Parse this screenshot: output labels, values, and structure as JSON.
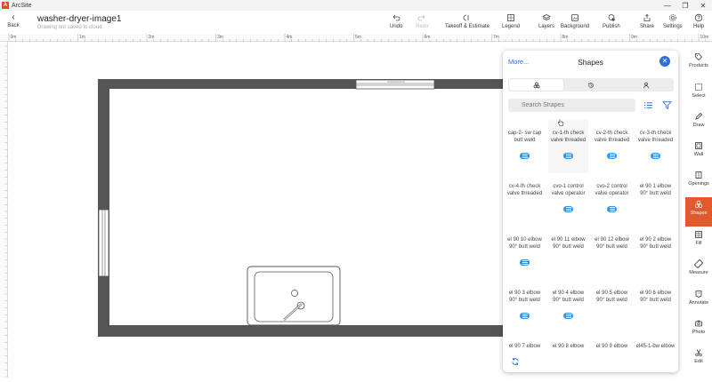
{
  "window": {
    "app_name": "ArcSite",
    "logo_letter": "A",
    "controls": [
      "—",
      "❐",
      "✕"
    ]
  },
  "toolbar": {
    "back_label": "Back",
    "title": "washer-dryer-image1",
    "subtitle": "Drawing not saved to cloud.",
    "tools": [
      {
        "name": "undo",
        "label": "Undo",
        "enabled": true
      },
      {
        "name": "redo",
        "label": "Redo",
        "enabled": false
      },
      {
        "name": "takeoff",
        "label": "Takeoff & Estimate",
        "enabled": true
      },
      {
        "name": "legend",
        "label": "Legend",
        "enabled": true
      },
      {
        "name": "layers",
        "label": "Layers",
        "enabled": true
      },
      {
        "name": "background",
        "label": "Background",
        "enabled": true
      },
      {
        "name": "publish",
        "label": "Publish",
        "enabled": true
      },
      {
        "name": "share",
        "label": "Share",
        "enabled": true
      },
      {
        "name": "settings",
        "label": "Settings",
        "enabled": true
      },
      {
        "name": "help",
        "label": "Help",
        "enabled": true
      }
    ]
  },
  "ruler": {
    "top_labels": [
      "0m",
      "1m",
      "2m",
      "3m",
      "4m",
      "5m",
      "6m",
      "7m",
      "8m",
      "9m",
      "10m"
    ]
  },
  "rail": {
    "items": [
      {
        "name": "products",
        "label": "Products",
        "active": false
      },
      {
        "name": "select",
        "label": "Select",
        "active": false
      },
      {
        "name": "draw",
        "label": "Draw",
        "active": false
      },
      {
        "name": "wall",
        "label": "Wall",
        "active": false
      },
      {
        "name": "openings",
        "label": "Openings",
        "active": false
      },
      {
        "name": "shapes",
        "label": "Shapes",
        "active": true
      },
      {
        "name": "fill",
        "label": "Fill",
        "active": false
      },
      {
        "name": "measure",
        "label": "Measure",
        "active": false
      },
      {
        "name": "annotate",
        "label": "Annotate",
        "active": false
      },
      {
        "name": "photo",
        "label": "Photo",
        "active": false
      },
      {
        "name": "edit",
        "label": "Edit",
        "active": false
      }
    ]
  },
  "panel": {
    "more_label": "More...",
    "title": "Shapes",
    "search_placeholder": "Search Shapes",
    "shapes": [
      {
        "label": "cap-2- sw cap butt weld",
        "badge": true
      },
      {
        "label": "cv-1-th check valve threaded",
        "badge": true
      },
      {
        "label": "cv-2-th check valve threaded",
        "badge": true
      },
      {
        "label": "cv-3-th check valve threaded",
        "badge": true
      },
      {
        "label": "cv-4-th check valve threaded",
        "badge": false
      },
      {
        "label": "cvo-1 control valve operator",
        "badge": true
      },
      {
        "label": "cvo-2 control valve operator",
        "badge": true
      },
      {
        "label": "el 90 1 elbow 90° butt weld",
        "badge": false
      },
      {
        "label": "el 90 10 elbow 90° butt weld",
        "badge": true
      },
      {
        "label": "el 90 11 elbow 90° butt weld",
        "badge": false
      },
      {
        "label": "el 90 12 elbow 90° butt weld",
        "badge": false
      },
      {
        "label": "el 90 2 elbow 90° butt weld",
        "badge": false
      },
      {
        "label": "el 90 3 elbow 90° butt weld",
        "badge": true
      },
      {
        "label": "el 90 4 elbow 90° butt weld",
        "badge": true
      },
      {
        "label": "el 90 5 elbow 90° butt weld",
        "badge": false
      },
      {
        "label": "el 90 6 elbow 90° butt weld",
        "badge": false
      },
      {
        "label": "el 90 7 elbow",
        "badge": false
      },
      {
        "label": "el 90 8 elbow",
        "badge": false
      },
      {
        "label": "el 90 9 elbow",
        "badge": false
      },
      {
        "label": "el45-1-bw elbow",
        "badge": false
      }
    ]
  },
  "colors": {
    "accent": "#e05a2b",
    "link": "#2a6fdb",
    "badge": "#3a91dd",
    "wall": "#555555"
  }
}
